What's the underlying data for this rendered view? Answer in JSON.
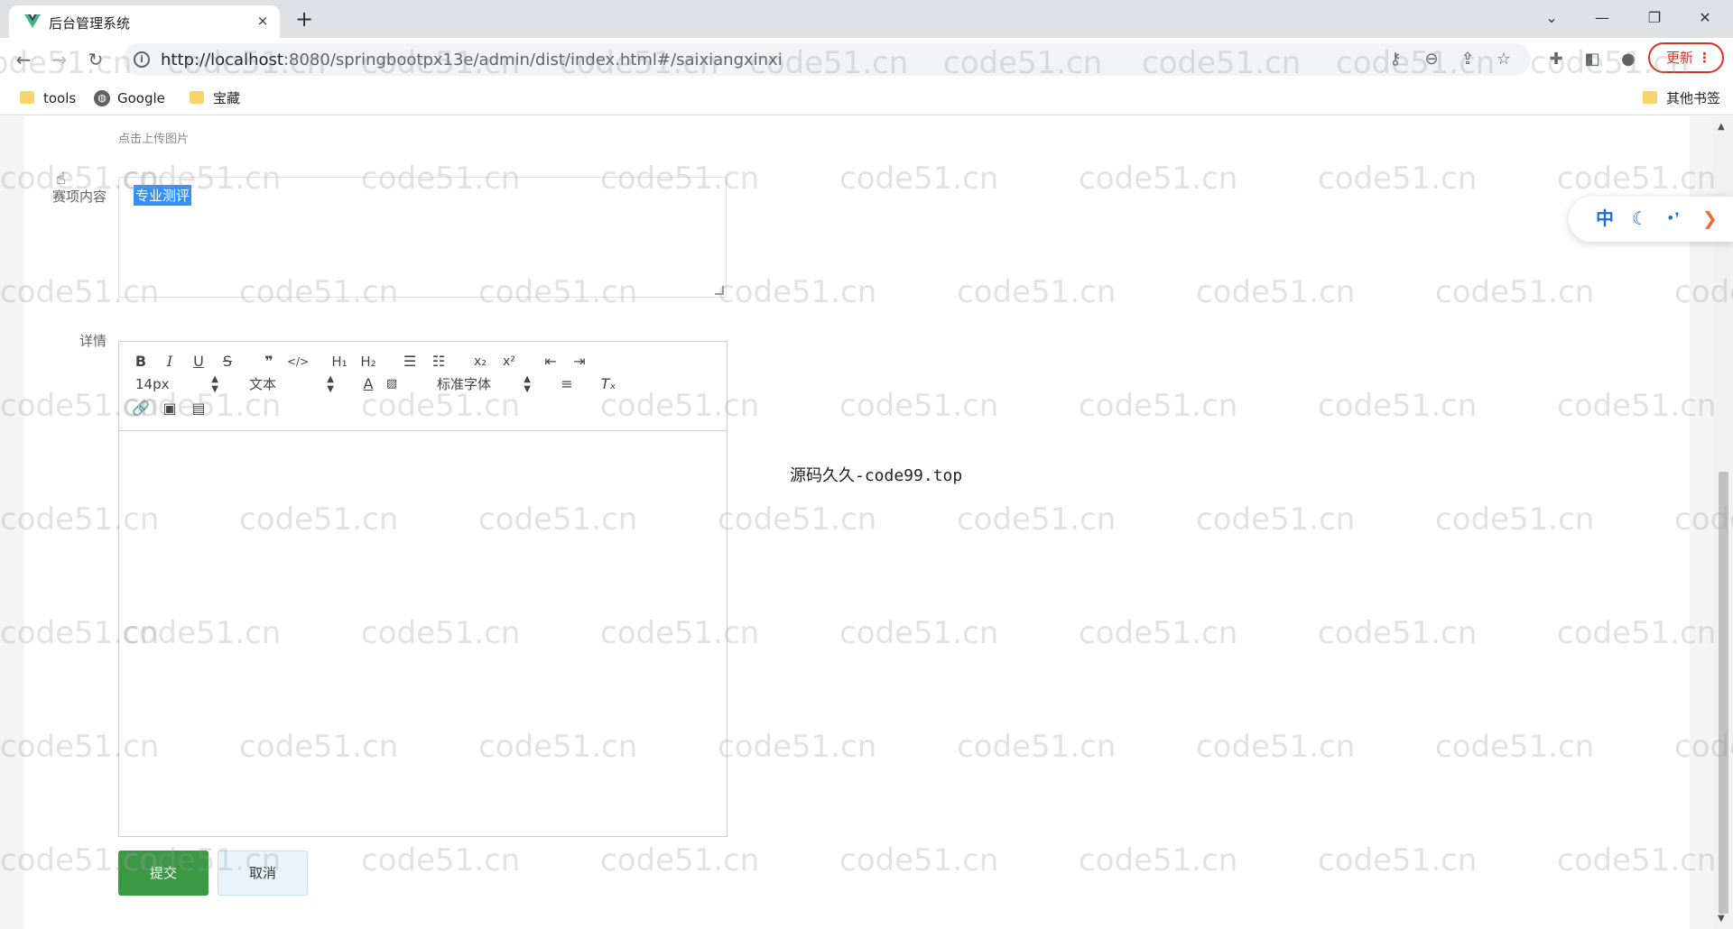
{
  "browser": {
    "tab_title": "后台管理系统",
    "tab_close": "×",
    "new_tab": "+",
    "url_host": "http://localhost",
    "url_rest": ":8080/springbootpx13e/admin/dist/index.html#/saixiangxinxi",
    "update_label": "更新",
    "bookmarks": [
      "tools",
      "Google",
      "宝藏"
    ],
    "other_bookmarks": "其他书签"
  },
  "form": {
    "upload_hint": "点击上传图片",
    "content_label": "赛项内容",
    "content_value": "专业测评",
    "detail_label": "详情",
    "submit_label": "提交",
    "cancel_label": "取消"
  },
  "editor": {
    "font_size": "14px",
    "header_type": "文本",
    "font_family": "标准字体",
    "buttons": [
      "bold",
      "italic",
      "underline",
      "strike",
      "blockquote",
      "code-block",
      "h1",
      "h2",
      "ordered-list",
      "bullet-list",
      "subscript",
      "superscript",
      "outdent",
      "indent",
      "color",
      "background",
      "align",
      "clean",
      "link",
      "image",
      "video"
    ]
  },
  "source_note": "源码久久-code99.top",
  "float_widget": {
    "lang": "中"
  },
  "watermark_text": "code51.cn"
}
